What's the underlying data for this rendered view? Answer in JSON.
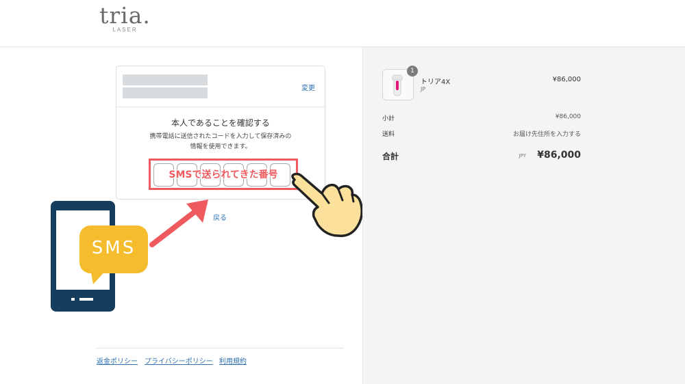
{
  "brand": {
    "logo_word": "tria.",
    "logo_sub": "LASER"
  },
  "verify": {
    "change_label": "変更",
    "title": "本人であることを確認する",
    "description_line1": "携帯電話に送信されたコードを入力して保存済みの",
    "description_line2": "情報を使用できます。",
    "code_caption": "SMSで送られてきた番号",
    "back_label": "戻る"
  },
  "phone_bubble": {
    "label": "SMS"
  },
  "order": {
    "product_name": "トリア4X",
    "product_variant": "JP",
    "quantity_badge": "1",
    "product_price": "¥86,000",
    "subtotal_label": "小計",
    "subtotal_value": "¥86,000",
    "shipping_label": "送料",
    "shipping_value": "お届け先住所を入力する",
    "total_label": "合計",
    "total_currency": "JPY",
    "total_value": "¥86,000"
  },
  "footer": {
    "links": [
      "返金ポリシー",
      "プライバシーポリシー",
      "利用規約"
    ]
  },
  "colors": {
    "accent_link": "#2f6fb1",
    "highlight_red": "#ef5a5f",
    "phone_navy": "#163e5c",
    "bubble_yellow": "#f5bd2e",
    "hand_yellow": "#fbe19b"
  },
  "icons": [
    "smartphone-icon",
    "sms-bubble-icon",
    "arrow-icon",
    "pointing-hand-icon"
  ]
}
